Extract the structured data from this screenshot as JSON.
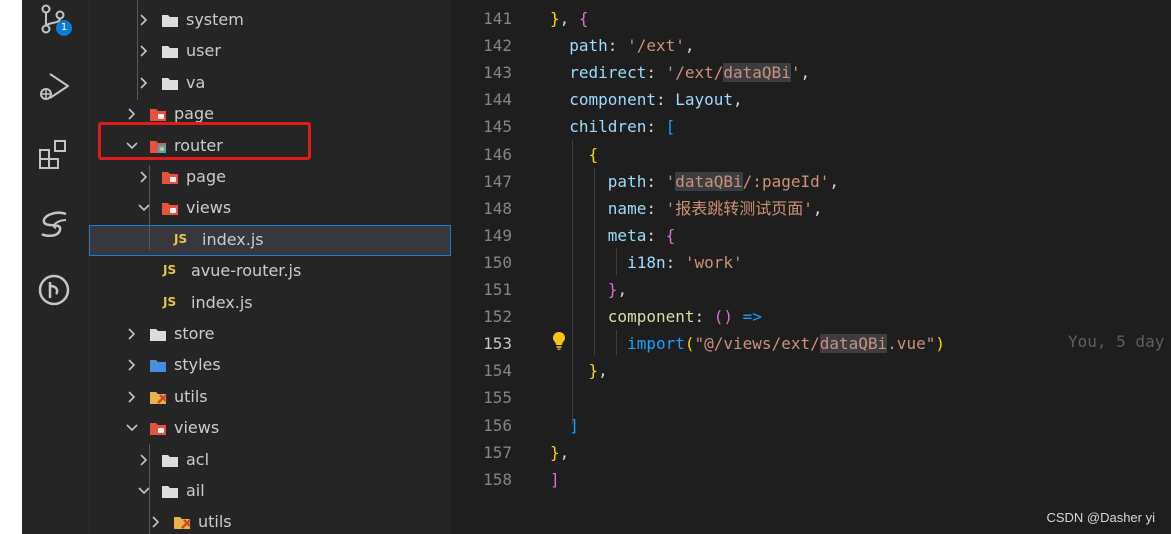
{
  "activity_bar": {
    "items": [
      {
        "icon": "source-control-icon",
        "badge": "1"
      },
      {
        "icon": "run-debug-icon"
      },
      {
        "icon": "extensions-icon"
      },
      {
        "icon": "sass-icon"
      },
      {
        "icon": "git-graph-icon"
      }
    ]
  },
  "explorer": {
    "rows": [
      {
        "label": "system",
        "chevron": "right",
        "icon": "folder-icon",
        "indent": 1
      },
      {
        "label": "user",
        "chevron": "right",
        "icon": "folder-icon",
        "indent": 1
      },
      {
        "label": "va",
        "chevron": "right",
        "icon": "folder-icon",
        "indent": 1
      },
      {
        "label": "page",
        "chevron": "right",
        "icon": "folder-orange-icon",
        "indent": 0
      },
      {
        "label": "router",
        "chevron": "down",
        "icon": "router-folder-icon",
        "indent": 0
      },
      {
        "label": "page",
        "chevron": "right",
        "icon": "folder-orange-icon",
        "indent": 1
      },
      {
        "label": "views",
        "chevron": "down",
        "icon": "folder-orange-icon",
        "indent": 1
      },
      {
        "label": "index.js",
        "chevron": "none",
        "icon": "js",
        "indent": 2,
        "selected": true
      },
      {
        "label": "avue-router.js",
        "chevron": "none",
        "icon": "js",
        "indent": 1
      },
      {
        "label": "index.js",
        "chevron": "none",
        "icon": "js",
        "indent": 1
      },
      {
        "label": "store",
        "chevron": "right",
        "icon": "folder-icon",
        "indent": 0
      },
      {
        "label": "styles",
        "chevron": "right",
        "icon": "styles-folder-icon",
        "indent": 0
      },
      {
        "label": "utils",
        "chevron": "right",
        "icon": "tools-folder-icon",
        "indent": 0
      },
      {
        "label": "views",
        "chevron": "down",
        "icon": "folder-orange-icon",
        "indent": 0
      },
      {
        "label": "acl",
        "chevron": "right",
        "icon": "folder-icon",
        "indent": 1
      },
      {
        "label": "ail",
        "chevron": "down",
        "icon": "folder-open-icon",
        "indent": 1
      },
      {
        "label": "utils",
        "chevron": "right",
        "icon": "tools-folder-icon",
        "indent": 2
      }
    ],
    "js_badge": "JS"
  },
  "editor": {
    "lines": [
      {
        "n": "141",
        "tokens": [
          [
            "y",
            "}"
          ],
          [
            "w",
            ", "
          ],
          [
            "p",
            "{"
          ]
        ]
      },
      {
        "n": "142",
        "tokens": [
          [
            "w",
            "  "
          ],
          [
            "k",
            "path"
          ],
          [
            "w",
            ": "
          ],
          [
            "s",
            "'/ext'"
          ],
          [
            "w",
            ","
          ]
        ]
      },
      {
        "n": "143",
        "tokens": [
          [
            "w",
            "  "
          ],
          [
            "k",
            "redirect"
          ],
          [
            "w",
            ": "
          ],
          [
            "s",
            "'/ext/"
          ],
          [
            "sh",
            "dataQBi"
          ],
          [
            "s",
            "'"
          ],
          [
            "w",
            ","
          ]
        ]
      },
      {
        "n": "144",
        "tokens": [
          [
            "w",
            "  "
          ],
          [
            "k",
            "component"
          ],
          [
            "w",
            ": "
          ],
          [
            "k",
            "Layout"
          ],
          [
            "w",
            ","
          ]
        ]
      },
      {
        "n": "145",
        "tokens": [
          [
            "w",
            "  "
          ],
          [
            "k",
            "children"
          ],
          [
            "w",
            ": "
          ],
          [
            "b",
            "["
          ]
        ]
      },
      {
        "n": "146",
        "tokens": [
          [
            "w",
            "    "
          ],
          [
            "y",
            "{"
          ]
        ]
      },
      {
        "n": "147",
        "tokens": [
          [
            "w",
            "      "
          ],
          [
            "k",
            "path"
          ],
          [
            "w",
            ": "
          ],
          [
            "s",
            "'"
          ],
          [
            "sh",
            "dataQBi"
          ],
          [
            "s",
            "/:pageId'"
          ],
          [
            "w",
            ","
          ]
        ]
      },
      {
        "n": "148",
        "tokens": [
          [
            "w",
            "      "
          ],
          [
            "k",
            "name"
          ],
          [
            "w",
            ": "
          ],
          [
            "s",
            "'报表跳转测试页面'"
          ],
          [
            "w",
            ","
          ]
        ]
      },
      {
        "n": "149",
        "tokens": [
          [
            "w",
            "      "
          ],
          [
            "k",
            "meta"
          ],
          [
            "w",
            ": "
          ],
          [
            "p",
            "{"
          ]
        ]
      },
      {
        "n": "150",
        "tokens": [
          [
            "w",
            "        "
          ],
          [
            "k",
            "i18n"
          ],
          [
            "w",
            ": "
          ],
          [
            "s",
            "'work'"
          ]
        ]
      },
      {
        "n": "151",
        "tokens": [
          [
            "w",
            "      "
          ],
          [
            "p",
            "}"
          ],
          [
            "w",
            ","
          ]
        ]
      },
      {
        "n": "152",
        "tokens": [
          [
            "w",
            "      "
          ],
          [
            "f",
            "component"
          ],
          [
            "w",
            ": "
          ],
          [
            "p",
            "()"
          ],
          [
            "w",
            " "
          ],
          [
            "b",
            "=>"
          ]
        ]
      },
      {
        "n": "153",
        "tokens": [
          [
            "w",
            "        "
          ],
          [
            "b",
            "import"
          ],
          [
            "y",
            "("
          ],
          [
            "s",
            "\"@/views/ext/"
          ],
          [
            "sh",
            "dataQBi"
          ],
          [
            "s",
            ".vue\""
          ],
          [
            "y",
            ")"
          ]
        ],
        "active": true
      },
      {
        "n": "154",
        "tokens": [
          [
            "w",
            "    "
          ],
          [
            "y",
            "}"
          ],
          [
            "w",
            ","
          ]
        ]
      },
      {
        "n": "155",
        "tokens": []
      },
      {
        "n": "156",
        "tokens": [
          [
            "w",
            "  "
          ],
          [
            "b",
            "]"
          ]
        ]
      },
      {
        "n": "157",
        "tokens": [
          [
            "y",
            "}"
          ],
          [
            "w",
            ","
          ]
        ]
      },
      {
        "n": "158",
        "tokens": [
          [
            "p",
            "]"
          ]
        ]
      }
    ],
    "blame": "You, 5 day"
  },
  "watermark": "CSDN @Dasher yi"
}
